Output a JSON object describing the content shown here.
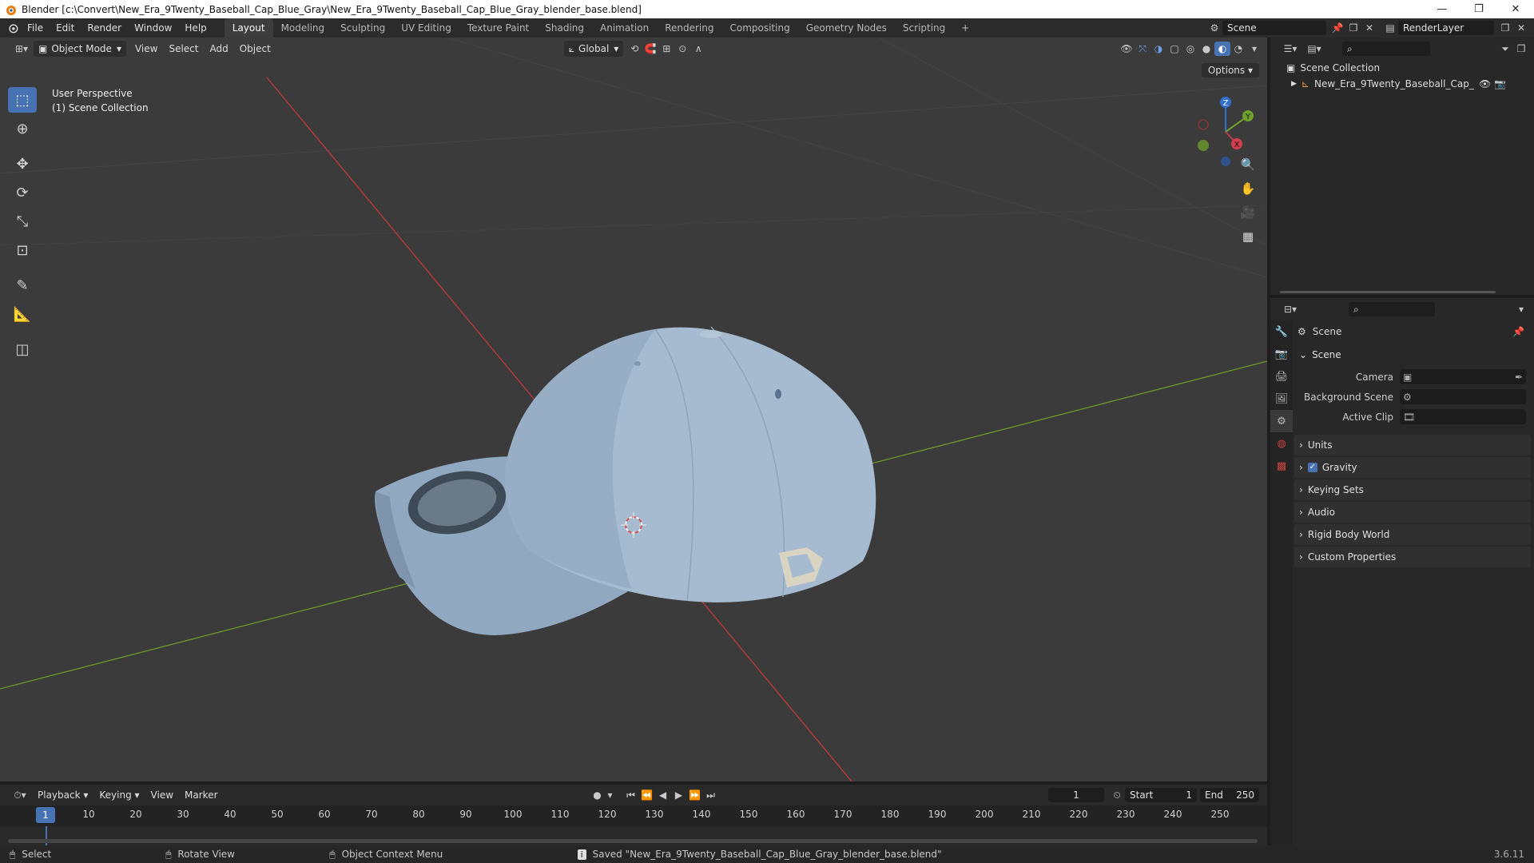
{
  "window": {
    "title": "Blender [c:\\Convert\\New_Era_9Twenty_Baseball_Cap_Blue_Gray\\New_Era_9Twenty_Baseball_Cap_Blue_Gray_blender_base.blend]",
    "min_glyph": "—",
    "max_glyph": "❐",
    "close_glyph": "✕"
  },
  "topbar": {
    "menus": [
      "File",
      "Edit",
      "Render",
      "Window",
      "Help"
    ],
    "workspaces": [
      "Layout",
      "Modeling",
      "Sculpting",
      "UV Editing",
      "Texture Paint",
      "Shading",
      "Animation",
      "Rendering",
      "Compositing",
      "Geometry Nodes",
      "Scripting"
    ],
    "active_workspace": "Layout",
    "add_workspace": "+",
    "scene": "Scene",
    "view_layer": "RenderLayer"
  },
  "viewport": {
    "mode": "Object Mode",
    "menus": [
      "View",
      "Select",
      "Add",
      "Object"
    ],
    "orientation": "Global",
    "options_label": "Options",
    "perspective_label": "User Perspective",
    "collection_label": "(1) Scene Collection",
    "gizmo": {
      "z": "Z",
      "y": "Y",
      "x": "X"
    }
  },
  "timeline": {
    "menus": [
      "Playback",
      "Keying",
      "View",
      "Marker"
    ],
    "current_frame": "1",
    "start_label": "Start",
    "start": "1",
    "end_label": "End",
    "end": "250",
    "ticks": [
      "10",
      "20",
      "30",
      "40",
      "50",
      "60",
      "70",
      "80",
      "90",
      "100",
      "110",
      "120",
      "130",
      "140",
      "150",
      "160",
      "170",
      "180",
      "190",
      "200",
      "210",
      "220",
      "230",
      "240",
      "250"
    ],
    "frame_cursor": "1"
  },
  "statusbar": {
    "select": "Select",
    "rotate": "Rotate View",
    "context": "Object Context Menu",
    "message": "Saved \"New_Era_9Twenty_Baseball_Cap_Blue_Gray_blender_base.blend\"",
    "version": "3.6.11"
  },
  "outliner": {
    "root": "Scene Collection",
    "object": "New_Era_9Twenty_Baseball_Cap_Blue_"
  },
  "properties": {
    "context_title": "Scene",
    "section_scene": "Scene",
    "camera_label": "Camera",
    "background_label": "Background Scene",
    "clip_label": "Active Clip",
    "panels": [
      "Units",
      "Gravity",
      "Keying Sets",
      "Audio",
      "Rigid Body World",
      "Custom Properties"
    ],
    "gravity_checked": true
  },
  "colors": {
    "accent": "#4772b3",
    "x_axis": "#c23a3a",
    "y_axis": "#6c9a2a",
    "cap": "#9fb4c9"
  }
}
